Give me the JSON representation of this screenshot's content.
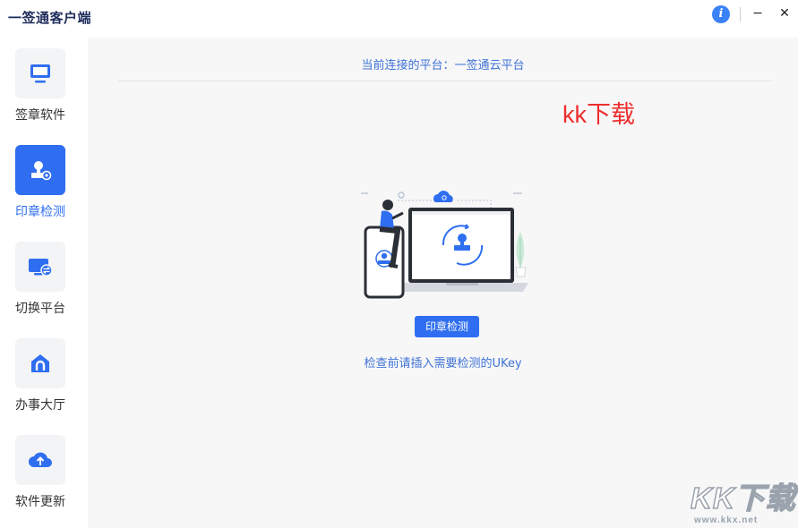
{
  "app": {
    "title": "一签通客户端",
    "info_glyph": "i",
    "minimize_glyph": "−",
    "close_glyph": "✕"
  },
  "sidebar": {
    "items": [
      {
        "label": "签章软件",
        "icon": "monitor-icon",
        "active": false
      },
      {
        "label": "印章检测",
        "icon": "stamp-detect-icon",
        "active": true
      },
      {
        "label": "切换平台",
        "icon": "switch-platform-icon",
        "active": false
      },
      {
        "label": "办事大厅",
        "icon": "home-icon",
        "active": false
      },
      {
        "label": "软件更新",
        "icon": "cloud-upload-icon",
        "active": false
      }
    ]
  },
  "main": {
    "platform_text": "当前连接的平台：一签通云平台",
    "detect_button": "印章检测",
    "hint": "检查前请插入需要检测的UKey"
  },
  "watermark": {
    "red_text": "kk下载",
    "logo_text": "KK下载",
    "url": "www.kkx.net"
  },
  "colors": {
    "accent": "#2f6ef0",
    "link_text": "#3f73d6",
    "watermark_red": "#ee2e2e"
  }
}
